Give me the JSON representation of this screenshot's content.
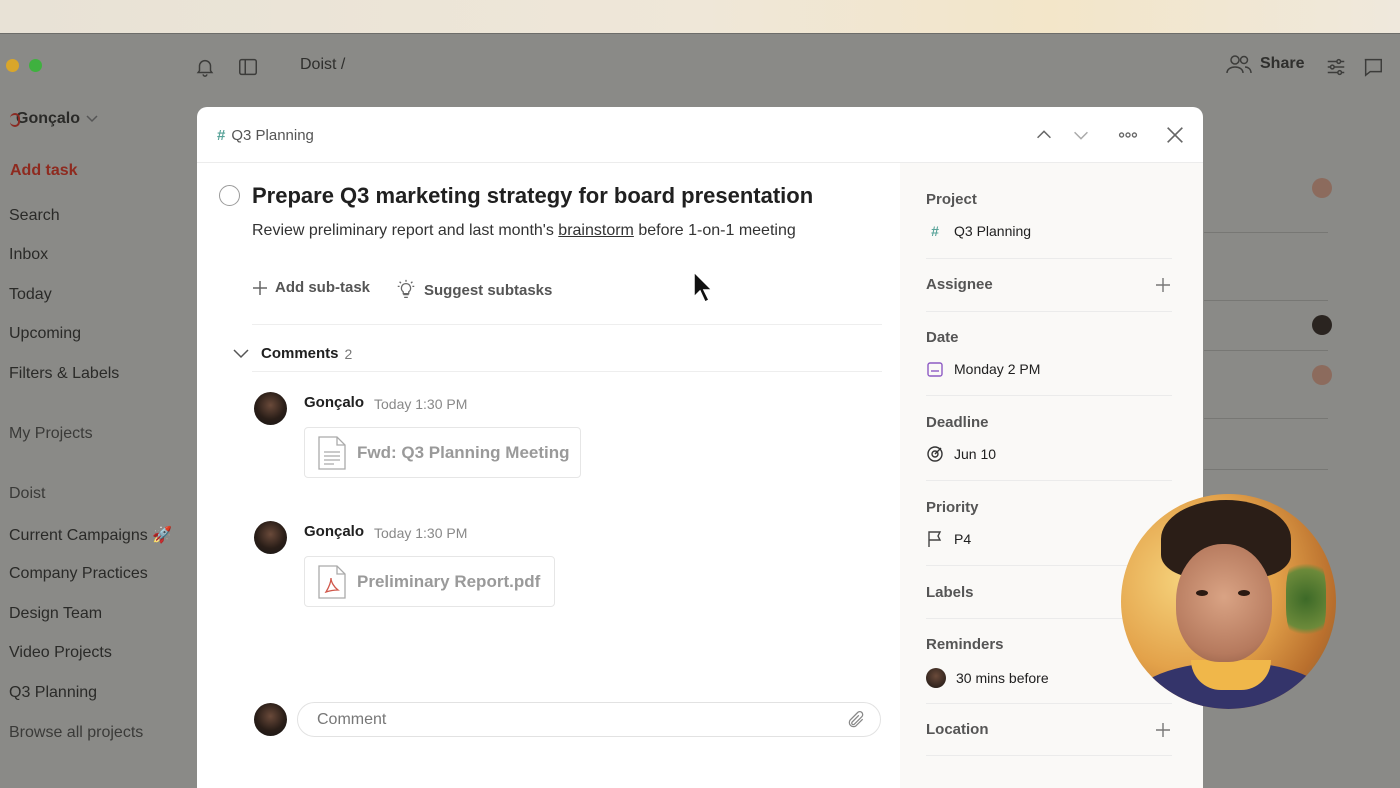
{
  "breadcrumb": "Doist /",
  "topbar": {
    "share_label": "Share"
  },
  "sidebar": {
    "user_name": "Gonçalo",
    "add_task": "Add task",
    "nav": [
      "Search",
      "Inbox",
      "Today",
      "Upcoming",
      "Filters & Labels"
    ],
    "my_projects": "My Projects",
    "team": "Doist",
    "projects": [
      "Current Campaigns 🚀",
      "Company Practices",
      "Design Team",
      "Video Projects",
      "Q3 Planning"
    ],
    "browse_all": "Browse all projects"
  },
  "modal": {
    "project_crumb": "Q3 Planning",
    "task_title": "Prepare Q3 marketing strategy for board presentation",
    "desc_before": "Review preliminary report and last month's ",
    "desc_link": "brainstorm",
    "desc_after": " before 1-on-1 meeting",
    "add_subtask": "Add sub-task",
    "suggest_subtasks": "Suggest subtasks",
    "comments_label": "Comments",
    "comments_count": "2",
    "comments": [
      {
        "author": "Gonçalo",
        "time": "Today 1:30 PM",
        "attachment": "Fwd: Q3 Planning Meeting",
        "attachment_icon": "document-icon"
      },
      {
        "author": "Gonçalo",
        "time": "Today 1:30 PM",
        "attachment": "Preliminary Report.pdf",
        "attachment_icon": "pdf-icon"
      }
    ],
    "comment_placeholder": "Comment"
  },
  "details": {
    "project_label": "Project",
    "project_value": "Q3 Planning",
    "assignee_label": "Assignee",
    "date_label": "Date",
    "date_value": "Monday 2 PM",
    "deadline_label": "Deadline",
    "deadline_value": "Jun 10",
    "priority_label": "Priority",
    "priority_value": "P4",
    "labels_label": "Labels",
    "reminders_label": "Reminders",
    "reminders_value": "30 mins before",
    "location_label": "Location"
  },
  "colors": {
    "accent_red": "#dc4c3e",
    "project_hash": "#58a399",
    "date_purple": "#8d5ac4"
  }
}
